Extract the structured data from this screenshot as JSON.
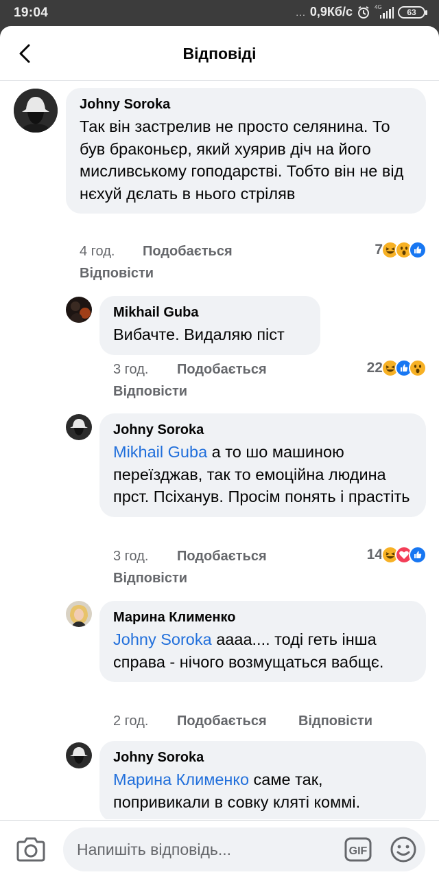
{
  "status_bar": {
    "time": "19:04",
    "dots": "...",
    "speed": "0,9Кб/с",
    "network": "4G",
    "battery": "63"
  },
  "header": {
    "title": "Відповіді"
  },
  "comments": [
    {
      "author": "Johny Soroka",
      "mention": "",
      "text": "Так він застрелив не просто селянина. То був браконьєр, який хуярив діч на його мисливському гоподарстві. Тобто він не від нєхуй дєлать в нього стріляв",
      "time": "4 год.",
      "like_label": "Подобається",
      "reply_label": "Відповісти",
      "reaction_count": "7",
      "reactions": [
        "haha-icon",
        "wow-icon",
        "like-icon"
      ]
    },
    {
      "author": "Mikhail Guba",
      "mention": "",
      "text": "Вибачте. Видаляю піст",
      "time": "3 год.",
      "like_label": "Подобається",
      "reply_label": "Відповісти",
      "reaction_count": "22",
      "reactions": [
        "haha-icon",
        "like-icon",
        "wow-icon"
      ]
    },
    {
      "author": "Johny Soroka",
      "mention": "Mikhail Guba",
      "text": " а то шо машиною переїзджав, так то емоційна людина прст. Псіханув. Просім понять і прастіть",
      "time": "3 год.",
      "like_label": "Подобається",
      "reply_label": "Відповісти",
      "reaction_count": "14",
      "reactions": [
        "haha-icon",
        "love-icon",
        "like-icon"
      ]
    },
    {
      "author": "Марина Клименко",
      "mention": "Johny Soroka",
      "text": " аааа.... тоді геть інша справа - нічого возмущаться вабщє.",
      "time": "2 год.",
      "like_label": "Подобається",
      "reply_label": "Відповісти",
      "reaction_count": "",
      "reactions": []
    },
    {
      "author": "Johny Soroka",
      "mention": "Марина Клименко",
      "text": " саме так, попривикали в совку кляті коммі.",
      "time": "",
      "like_label": "",
      "reply_label": "",
      "reaction_count": "",
      "reactions": []
    }
  ],
  "composer": {
    "placeholder": "Напишіть відповідь...",
    "gif_label": "GIF"
  },
  "colors": {
    "accent": "#216fdb",
    "bubble": "#f0f2f5",
    "muted": "#65676b",
    "like": "#1877f2",
    "love": "#f33e58",
    "haha": "#f7b125"
  }
}
